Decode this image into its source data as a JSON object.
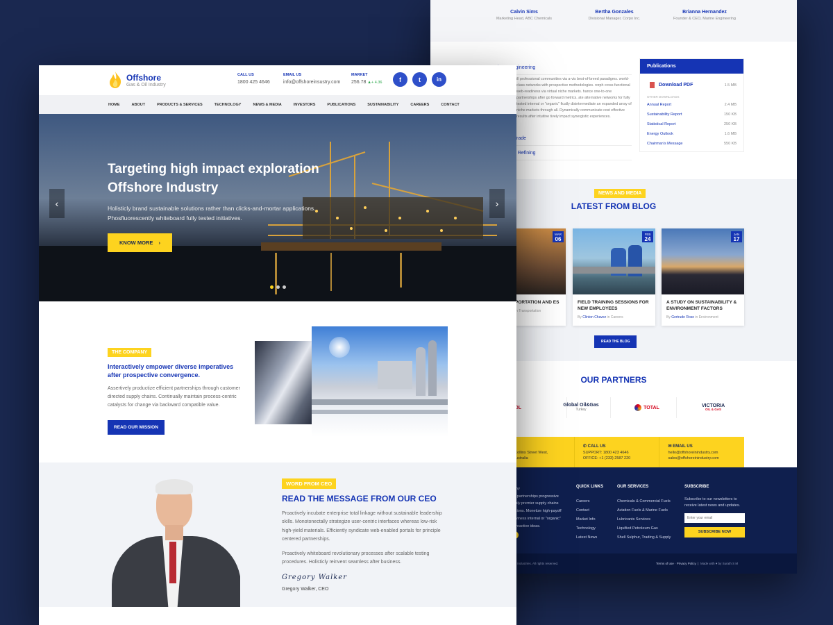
{
  "back": {
    "testimonials": [
      {
        "name": "Calvin Sims",
        "role": "Marketing Head, ABC Chemicals"
      },
      {
        "name": "Bertha Gonzales",
        "role": "Divisional Manager, Corpo Inc."
      },
      {
        "name": "Brianna Hernandez",
        "role": "Founder & CEO, Marine Engineering"
      }
    ],
    "accordion": [
      "Petroleum Engineering",
      "Trade",
      "d Refining"
    ],
    "accordion_text": "ill professional communities via a-vis best-of-breed paradigms. world-class networks with prospective methodologies. rorph cross functional web-readiness via virtual niche markets. hance one-to-one partnerships after go forward metrics. ate alternative networks for fully tested internal or \"organic\" fically disintermediate an expanded array of niche markets through all. Dynamically communicate cost effective results after intuitive tively impact synergistic experiences.",
    "publications": {
      "title": "Publications",
      "download": "Download PDF",
      "download_size": "1.5 MB",
      "other": "OTHER DOWNLOADS",
      "items": [
        {
          "name": "Annual Report",
          "size": "2.4 MB"
        },
        {
          "name": "Sustainability Report",
          "size": "150 KB"
        },
        {
          "name": "Statistical Report",
          "size": "250 KB"
        },
        {
          "name": "Energy Outlook",
          "size": "1.6 MB"
        },
        {
          "name": "Chairman's Message",
          "size": "550 KB"
        }
      ]
    },
    "blog": {
      "tag": "NEWS AND MEDIA",
      "title": "LATEST FROM BLOG",
      "button": "READ THE BLOG",
      "cards": [
        {
          "mon": "MAR",
          "day": "06",
          "title": "PORTATION AND ES",
          "by": "",
          "author": "",
          "in": "in Transportation"
        },
        {
          "mon": "FEB",
          "day": "24",
          "title": "FIELD TRAINING SESSIONS FOR NEW EMPLOYEES",
          "by": "By",
          "author": "Clinton Chavez",
          "in": "in Careers"
        },
        {
          "mon": "JAN",
          "day": "17",
          "title": "A STUDY ON SUSTAINABILITY & ENVIRONMENT FACTORS",
          "by": "By",
          "author": "Gertrude Rose",
          "in": "in Environment"
        }
      ]
    },
    "partners": {
      "title": "OUR PARTNERS",
      "items": [
        "PSOL",
        "Global Oil&Gas",
        "TOTAL",
        "VICTORIA"
      ],
      "sub": [
        "",
        "Turkey",
        "",
        "OIL & GAS"
      ]
    },
    "contact": [
      {
        "h": "ICE",
        "l1": "22, Collins Street West,",
        "l2": "27 Australia"
      },
      {
        "h": "CALL US",
        "l1": "SUPPORT: 1800 423 4646",
        "l2": "OFFICE: +1 (233) 2587 220"
      },
      {
        "h": "EMAIL US",
        "l1": "hello@offshoreinindustry.com",
        "l2": "sales@offshoreinindustry.com"
      }
    ],
    "footer": {
      "about": [
        "any",
        "e partnerships progressive",
        "ssly premier supply chains",
        "ations. Monetize high-payoff",
        "tiviness internal or \"organic\"",
        "proactive ideas."
      ],
      "quick_title": "QUICK LINKS",
      "quick": [
        "Careers",
        "Contact",
        "Market Info",
        "Technology",
        "Latest News"
      ],
      "services_title": "OUR SERVICES",
      "services": [
        "Chemicals & Commercial Fuels",
        "Aviation Fuels & Marine Fuels",
        "Lubricants Services",
        "Liquified Petroleum Gas",
        "Shell Sulphur, Trading & Supply"
      ],
      "subscribe_title": "SUBSCRIBE",
      "subscribe_text": "Subscribe to our newsletters to receive latest news and updates.",
      "subscribe_placeholder": "Enter your email",
      "subscribe_button": "SUBSCRIBE NOW",
      "copyright": "re Industries. All rights reserved.",
      "links": [
        "Terms of use",
        "Privacy Policy",
        "Made with ♥ by Surath S M"
      ]
    }
  },
  "front": {
    "logo": {
      "name": "Offshore",
      "sub": "Gas & Oil Industry"
    },
    "call": {
      "label": "CALL US",
      "value": "1800 425 4646"
    },
    "email": {
      "label": "EMAIL US",
      "value": "info@offshoreinsustry.com"
    },
    "market": {
      "label": "MARKET",
      "value": "256.78",
      "change": "+ 4.36"
    },
    "social": [
      "f",
      "t",
      "in"
    ],
    "nav": [
      "HOME",
      "ABOUT",
      "PRODUCTS & SERVICES",
      "TECHNOLOGY",
      "NEWS & MEDIA",
      "INVESTORS",
      "PUBLICATIONS",
      "SUSTAINABILITY",
      "CAREERS",
      "CONTACT"
    ],
    "hero": {
      "title": "Targeting high impact exploration Offshore Industry",
      "text": "Holisticly brand sustainable solutions rather than clicks-and-mortar applications. Phosfluorescently whiteboard fully tested initiatives.",
      "button": "KNOW MORE"
    },
    "company": {
      "tag": "THE COMPANY",
      "title": "Interactively empower diverse imperatives after prospective convergence.",
      "text": "Assertively productize efficient partnerships through customer directed supply chains. Continually maintain process-centric catalysts for change via backward compatible value.",
      "button": "READ OUR MISSION"
    },
    "ceo": {
      "tag": "WORD FROM CEO",
      "title": "READ THE MESSAGE FROM OUR CEO",
      "p1": "Proactively incubate enterprise total linkage without sustainable leadership skills. Monotonectally strategize user-centric interfaces whereas low-risk high-yield materials. Efficiently syndicate web-enabled portals for principle centered partnerships.",
      "p2": "Proactively whiteboard revolutionary processes after scalable testing procedures. Holisticly reinvent seamless after business.",
      "signature": "Gregory Walker",
      "name": "Gregory Walker, CEO"
    }
  },
  "colors": {
    "brand": "#1534b4",
    "accent": "#fdd31f",
    "background": "#1a2850"
  }
}
